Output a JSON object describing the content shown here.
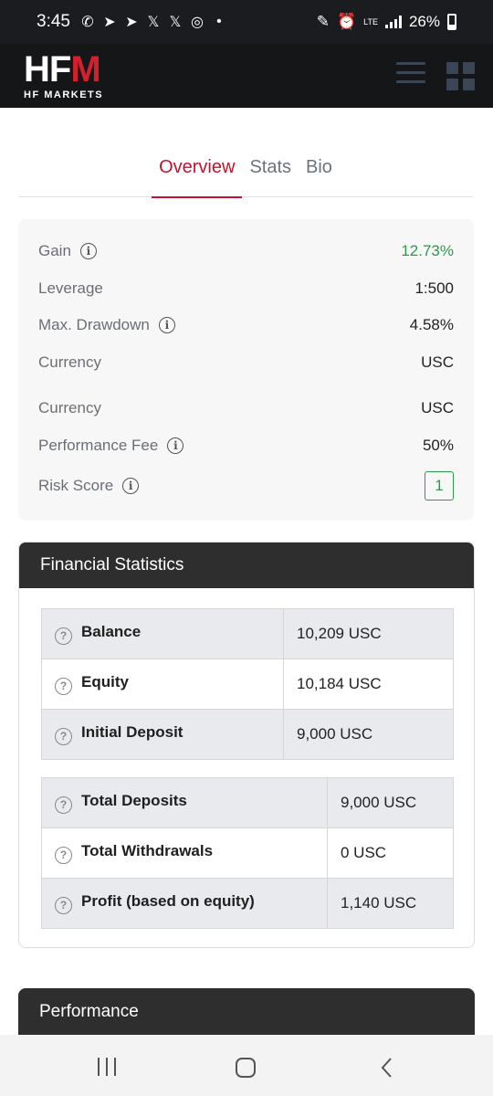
{
  "status_bar": {
    "time": "3:45",
    "battery": "26%",
    "network": "LTE"
  },
  "header": {
    "logo_main": "HFM",
    "logo_sub": "HF MARKETS"
  },
  "tabs": [
    {
      "label": "Overview",
      "active": true
    },
    {
      "label": "Stats",
      "active": false
    },
    {
      "label": "Bio",
      "active": false
    }
  ],
  "overview": {
    "rows": [
      {
        "label": "Gain",
        "value": "12.73%",
        "info": true
      },
      {
        "label": "Leverage",
        "value": "1:500",
        "info": false
      },
      {
        "label": "Max. Drawdown",
        "value": "4.58%",
        "info": true
      },
      {
        "label": "Currency",
        "value": "USC",
        "info": false
      },
      {
        "label": "Currency",
        "value": "USC",
        "info": false
      },
      {
        "label": "Performance Fee",
        "value": "50%",
        "info": true
      },
      {
        "label": "Risk Score",
        "value": "1",
        "info": true
      }
    ]
  },
  "financial_statistics": {
    "title": "Financial Statistics",
    "table1": [
      {
        "label": "Balance",
        "value": "10,209 USC"
      },
      {
        "label": "Equity",
        "value": "10,184 USC"
      },
      {
        "label": "Initial Deposit",
        "value": "9,000 USC"
      }
    ],
    "table2": [
      {
        "label": "Total Deposits",
        "value": "9,000 USC"
      },
      {
        "label": "Total Withdrawals",
        "value": "0 USC"
      },
      {
        "label": "Profit (based on equity)",
        "value": "1,140 USC"
      }
    ]
  },
  "performance": {
    "title": "Performance"
  },
  "colors": {
    "accent": "#c8102e",
    "gain_green": "#2e9a4b",
    "header_bg": "#151618",
    "section_header_bg": "#2e2e2e"
  }
}
